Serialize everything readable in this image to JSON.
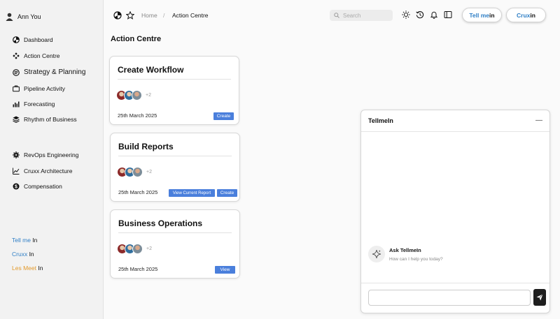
{
  "user": {
    "name": "Ann You"
  },
  "sidebar": {
    "items": [
      {
        "label": "Dashboard",
        "icon": "dashboard-icon"
      },
      {
        "label": "Action Centre",
        "icon": "action-centre-icon"
      },
      {
        "label": "Strategy & Planning",
        "icon": "strategy-icon"
      },
      {
        "label": "Pipeline Activity",
        "icon": "pipeline-icon"
      },
      {
        "label": "Forecasting",
        "icon": "forecasting-icon"
      },
      {
        "label": "Rhythm of Business",
        "icon": "rhythm-icon"
      },
      {
        "label": "RevOps Engineering",
        "icon": "gear-icon"
      },
      {
        "label": "Cruxx Architecture",
        "icon": "architecture-icon"
      },
      {
        "label": "Compensation",
        "icon": "compensation-icon"
      }
    ],
    "apps": [
      {
        "colored": "Tell me",
        "plain": " In",
        "color": "#2f7fc6"
      },
      {
        "colored": "Cruxx",
        "plain": " In",
        "color": "#2f7fc6"
      },
      {
        "colored": "Les Meet",
        "plain": " In",
        "color": "#e39a2c"
      }
    ]
  },
  "header": {
    "breadcrumb": {
      "home": "Home",
      "separator": "/",
      "current": "Action Centre"
    },
    "search_placeholder": "Search",
    "pills": [
      {
        "colored": "Tell me",
        "plain": " in",
        "color": "#2f7fc6"
      },
      {
        "colored": "Crux",
        "plain": " in",
        "color": "#2f7fc6"
      }
    ]
  },
  "main": {
    "title": "Action Centre",
    "cards": [
      {
        "title": "Create Workflow",
        "more": "+2",
        "date": "25th March 2025",
        "buttons": [
          "Create"
        ]
      },
      {
        "title": "Build Reports",
        "more": "+2",
        "date": "25th March 2025",
        "buttons": [
          "View Current Report",
          "Create"
        ]
      },
      {
        "title": "Business Operations",
        "more": "+2",
        "date": "25th March 2025",
        "buttons": [
          "View"
        ]
      }
    ]
  },
  "chat": {
    "title": "TellmeIn",
    "minimize": "—",
    "ask_title": "Ask TellmeIn",
    "ask_sub": "How can I help you today?",
    "input_placeholder": ""
  },
  "colors": {
    "accent": "#4a7fdc",
    "brand_blue": "#2f7fc6",
    "brand_orange": "#e39a2c"
  }
}
